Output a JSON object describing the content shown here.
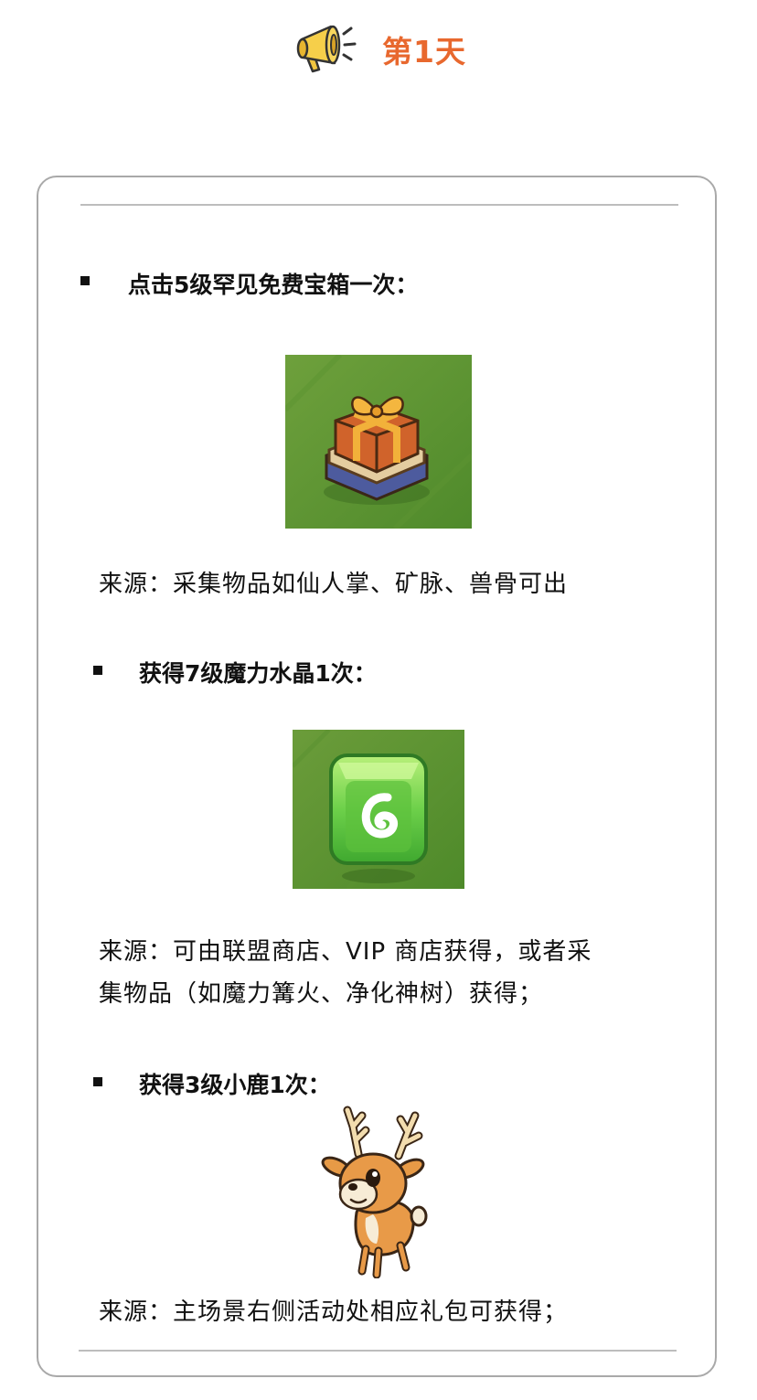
{
  "header": {
    "title": "第1天",
    "icon": "megaphone-icon",
    "accent_color": "#e8682e"
  },
  "items": [
    {
      "heading": "点击5级罕见免费宝箱一次：",
      "image": "gift-box-icon",
      "source_lines": [
        "来源：采集物品如仙人掌、矿脉、兽骨可出"
      ]
    },
    {
      "heading": "获得7级魔力水晶1次：",
      "image": "magic-crystal-icon",
      "source_lines": [
        "来源：可由联盟商店、VIP 商店获得，或者采",
        "集物品（如魔力篝火、净化神树）获得；"
      ]
    },
    {
      "heading": "获得3级小鹿1次：",
      "image": "fawn-icon",
      "source_lines": [
        "来源：主场景右侧活动处相应礼包可获得；"
      ]
    }
  ]
}
